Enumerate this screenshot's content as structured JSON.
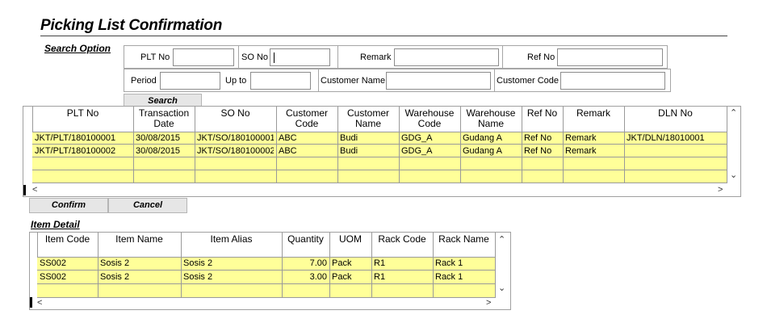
{
  "title": "Picking List Confirmation",
  "search": {
    "heading": "Search Option",
    "plt_no_label": "PLT No",
    "so_no_label": "SO No",
    "remark_label": "Remark",
    "ref_no_label": "Ref No",
    "period_label": "Period",
    "up_to_label": "Up to",
    "customer_name_label": "Customer Name",
    "customer_code_label": "Customer Code",
    "search_button": "Search"
  },
  "picking_grid": {
    "headers": [
      "PLT No",
      "Transaction\nDate",
      "SO No",
      "Customer\nCode",
      "Customer\nName",
      "Warehouse\nCode",
      "Warehouse\nName",
      "Ref No",
      "Remark",
      "DLN No"
    ],
    "rows": [
      [
        "JKT/PLT/180100001",
        "30/08/2015",
        "JKT/SO/180100001",
        "ABC",
        "Budi",
        "GDG_A",
        "Gudang A",
        "Ref No",
        "Remark",
        "JKT/DLN/18010001"
      ],
      [
        "JKT/PLT/180100002",
        "30/08/2015",
        "JKT/SO/180100002",
        "ABC",
        "Budi",
        "GDG_A",
        "Gudang A",
        "Ref No",
        "Remark",
        ""
      ]
    ]
  },
  "actions": {
    "confirm": "Confirm",
    "cancel": "Cancel"
  },
  "item_detail": {
    "heading": "Item Detail",
    "headers": [
      "Item Code",
      "Item Name",
      "Item Alias",
      "Quantity",
      "UOM",
      "Rack Code",
      "Rack Name"
    ],
    "rows": [
      [
        "SS002",
        "Sosis 2",
        "Sosis 2",
        "7.00",
        "Pack",
        "R1",
        "Rack 1"
      ],
      [
        "SS002",
        "Sosis 2",
        "Sosis 2",
        "3.00",
        "Pack",
        "R1",
        "Rack 1"
      ]
    ]
  },
  "scroll_glyphs": {
    "up": "⌃",
    "down": "⌄",
    "left": "<",
    "right": ">"
  },
  "colors": {
    "row_fill": "#ffff99",
    "button_fill": "#e6e6e6"
  }
}
